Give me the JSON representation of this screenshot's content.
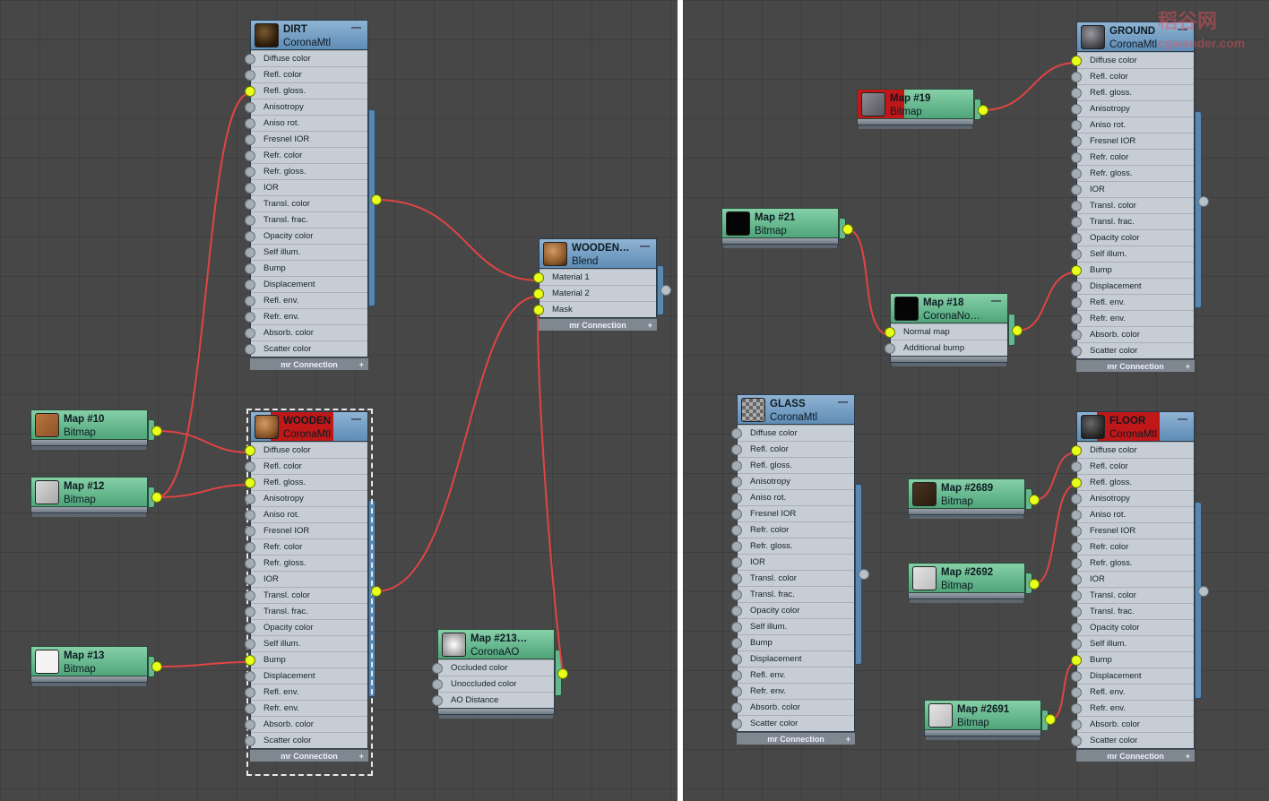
{
  "colors": {
    "wire": "#e04444",
    "active_socket": "#e8ff1c",
    "material_header": "#6f9cc4",
    "map_header": "#63b88d",
    "selection_tag": "#c01818",
    "canvas": "#474747"
  },
  "common": {
    "footer_label": "mr Connection",
    "footer_plus": "+",
    "collapse_icon": "—"
  },
  "left": {
    "dirt": {
      "title": "DIRT",
      "type": "CoronaMtl",
      "thumb": "dark-brown-sphere",
      "slots": [
        "Diffuse color",
        "Refl. color",
        "Refl. gloss.",
        "Anisotropy",
        "Aniso rot.",
        "Fresnel IOR",
        "Refr. color",
        "Refr. gloss.",
        "IOR",
        "Transl. color",
        "Transl. frac.",
        "Opacity color",
        "Self illum.",
        "Bump",
        "Displacement",
        "Refl. env.",
        "Refr. env.",
        "Absorb. color",
        "Scatter color"
      ]
    },
    "wooden_blend": {
      "title": "WOODEN…",
      "type": "Blend",
      "thumb": "wood-sphere",
      "slots": [
        "Material 1",
        "Material 2",
        "Mask"
      ]
    },
    "wooden": {
      "title": "WOODEN",
      "type": "CoronaMtl",
      "thumb": "wood-sphere",
      "slots": [
        "Diffuse color",
        "Refl. color",
        "Refl. gloss.",
        "Anisotropy",
        "Aniso rot.",
        "Fresnel IOR",
        "Refr. color",
        "Refr. gloss.",
        "IOR",
        "Transl. color",
        "Transl. frac.",
        "Opacity color",
        "Self illum.",
        "Bump",
        "Displacement",
        "Refl. env.",
        "Refr. env.",
        "Absorb. color",
        "Scatter color"
      ]
    },
    "map10": {
      "title": "Map #10",
      "type": "Bitmap",
      "thumb": "wood-texture"
    },
    "map12": {
      "title": "Map #12",
      "type": "Bitmap",
      "thumb": "grey-texture"
    },
    "map13": {
      "title": "Map #13",
      "type": "Bitmap",
      "thumb": "white-texture"
    },
    "map213": {
      "title": "Map #213…",
      "type": "CoronaAO",
      "thumb": "ao-swatch",
      "slots": [
        "Occluded color",
        "Unoccluded color",
        "AO Distance"
      ]
    }
  },
  "right": {
    "ground": {
      "title": "GROUND",
      "type": "CoronaMtl",
      "thumb": "rock-sphere",
      "slots": [
        "Diffuse color",
        "Refl. color",
        "Refl. gloss.",
        "Anisotropy",
        "Aniso rot.",
        "Fresnel IOR",
        "Refr. color",
        "Refr. gloss.",
        "IOR",
        "Transl. color",
        "Transl. frac.",
        "Opacity color",
        "Self illum.",
        "Bump",
        "Displacement",
        "Refl. env.",
        "Refr. env.",
        "Absorb. color",
        "Scatter color"
      ]
    },
    "map19": {
      "title": "Map #19",
      "type": "Bitmap",
      "thumb": "rock-texture"
    },
    "map21": {
      "title": "Map #21",
      "type": "Bitmap",
      "thumb": "black-texture"
    },
    "map18": {
      "title": "Map #18",
      "type": "CoronaNo…",
      "thumb": "black-texture",
      "slots": [
        "Normal map",
        "Additional bump"
      ]
    },
    "glass": {
      "title": "GLASS",
      "type": "CoronaMtl",
      "thumb": "checker-sphere",
      "slots": [
        "Diffuse color",
        "Refl. color",
        "Refl. gloss.",
        "Anisotropy",
        "Aniso rot.",
        "Fresnel IOR",
        "Refr. color",
        "Refr. gloss.",
        "IOR",
        "Transl. color",
        "Transl. frac.",
        "Opacity color",
        "Self illum.",
        "Bump",
        "Displacement",
        "Refl. env.",
        "Refr. env.",
        "Absorb. color",
        "Scatter color"
      ]
    },
    "floor": {
      "title": "FLOOR",
      "type": "CoronaMtl",
      "thumb": "dark-sphere",
      "slots": [
        "Diffuse color",
        "Refl. color",
        "Refl. gloss.",
        "Anisotropy",
        "Aniso rot.",
        "Fresnel IOR",
        "Refr. color",
        "Refr. gloss.",
        "IOR",
        "Transl. color",
        "Transl. frac.",
        "Opacity color",
        "Self illum.",
        "Bump",
        "Displacement",
        "Refl. env.",
        "Refr. env.",
        "Absorb. color",
        "Scatter color"
      ]
    },
    "map2689": {
      "title": "Map #2689",
      "type": "Bitmap",
      "thumb": "dark-wood-texture"
    },
    "map2692": {
      "title": "Map #2692",
      "type": "Bitmap",
      "thumb": "light-grey-texture"
    },
    "map2691": {
      "title": "Map #2691",
      "type": "Bitmap",
      "thumb": "light-grey-texture"
    }
  },
  "watermark": {
    "line1": "稻谷网",
    "line2": "cgwander.com"
  }
}
